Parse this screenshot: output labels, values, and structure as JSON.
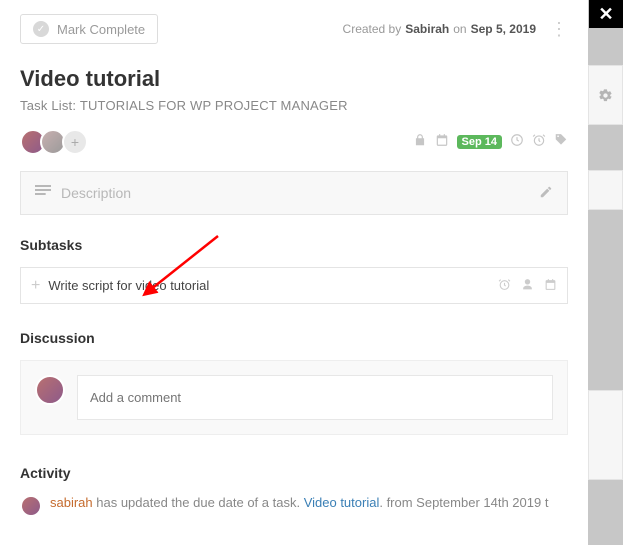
{
  "header": {
    "mark_complete": "Mark Complete",
    "created_prefix": "Created by",
    "creator": "Sabirah",
    "on_word": "on",
    "created_date": "Sep 5, 2019"
  },
  "task": {
    "title": "Video tutorial",
    "list_prefix": "Task List:",
    "list_name": "TUTORIALS FOR WP PROJECT MANAGER"
  },
  "meta": {
    "due_badge": "Sep 14"
  },
  "description": {
    "placeholder": "Description"
  },
  "subtasks": {
    "heading": "Subtasks",
    "input_value": "Write script for video tutorial"
  },
  "discussion": {
    "heading": "Discussion",
    "comment_placeholder": "Add a comment"
  },
  "activity": {
    "heading": "Activity",
    "actor": "sabirah",
    "text_mid": " has updated the due date of a task. ",
    "link": "Video tutorial",
    "text_tail": ". from September 14th 2019 t"
  }
}
